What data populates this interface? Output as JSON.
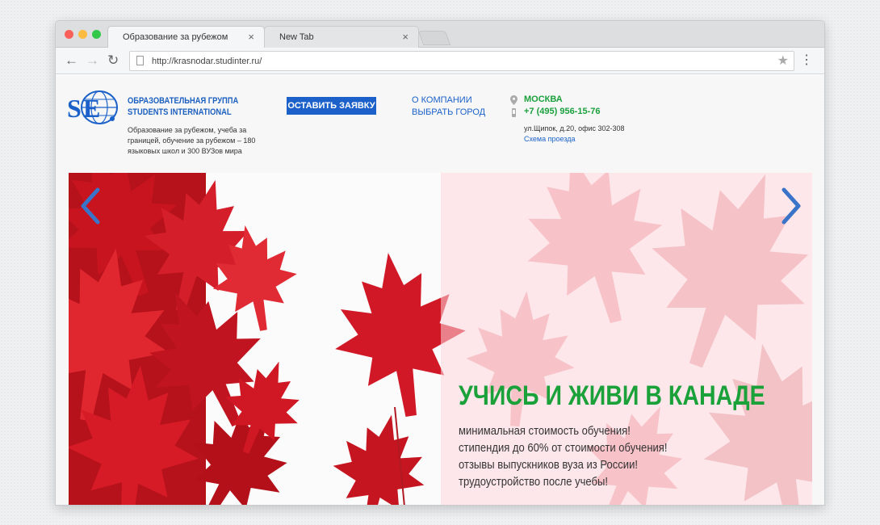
{
  "browser": {
    "tabs": [
      {
        "title": "Образование за рубежом"
      },
      {
        "title": "New Tab"
      }
    ],
    "close_glyph": "×",
    "url": "http://krasnodar.studinter.ru/",
    "icons": {
      "back": "←",
      "forward": "→",
      "reload": "↻",
      "star": "★",
      "menu": "⋮"
    },
    "traffic_lights": [
      "#fc605b",
      "#fdbc40",
      "#34c84a"
    ]
  },
  "header": {
    "brand_line1": "ОБРАЗОВАТЕЛЬНАЯ ГРУППА",
    "brand_line2": "STUDENTS INTERNATIONAL",
    "tagline": "Образование за рубежом, учеба за границей, обучение за рубежом – 180 языковых школ и 300 ВУЗов мира",
    "cta": "ОСТАВИТЬ ЗАЯВКУ",
    "nav": [
      "О КОМПАНИИ",
      "ВЫБРАТЬ ГОРОД"
    ],
    "city": "МОСКВА",
    "phone": "+7 (495) 956-15-76",
    "address": "ул.Щипок, д.20, офис 302-308",
    "route_link": "Схема проезда"
  },
  "slide": {
    "title": "УЧИСЬ И ЖИВИ В КАНАДЕ",
    "features": [
      "минимальная стоимость обучения!",
      "стипендия до 60% от стоимости обучения!",
      "отзывы выпускников вуза из России!",
      "трудоустройство после учебы!"
    ]
  },
  "colors": {
    "brand_blue": "#1b61c9",
    "accent_green": "#1aa13a",
    "leaf_red": "#d7192b"
  }
}
